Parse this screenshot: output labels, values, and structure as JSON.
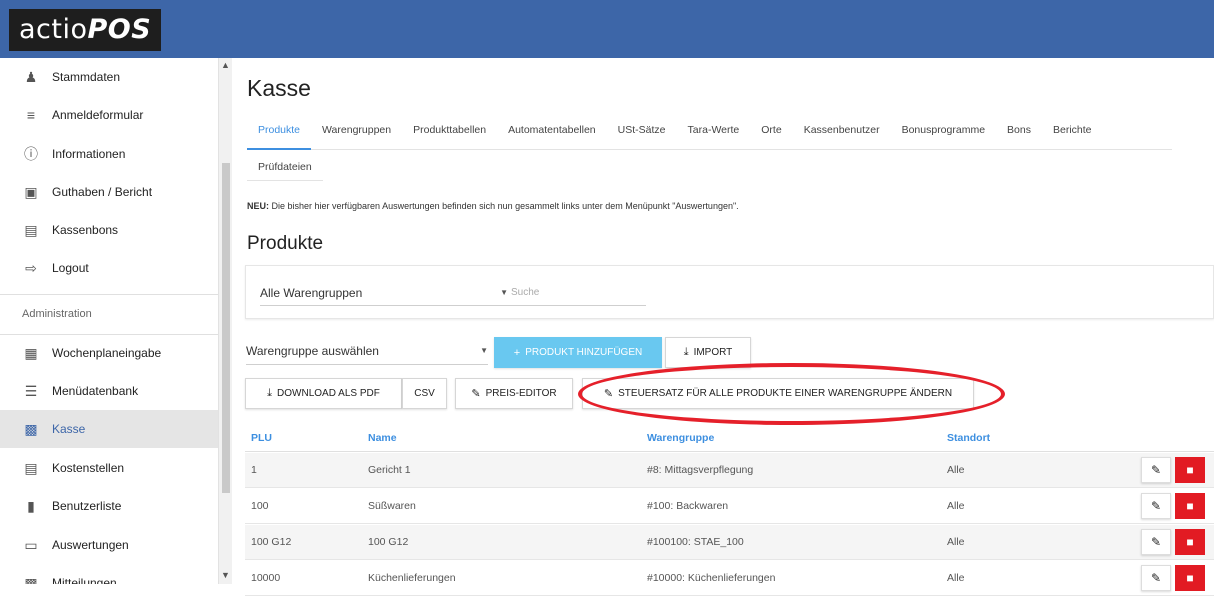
{
  "app": {
    "logo_plain": "actio",
    "logo_bold": "POS"
  },
  "sidebar": {
    "items": [
      {
        "label": "Stammdaten",
        "icon": "person-icon"
      },
      {
        "label": "Anmeldeformular",
        "icon": "form-lines-icon"
      },
      {
        "label": "Informationen",
        "icon": "info-icon"
      },
      {
        "label": "Guthaben / Bericht",
        "icon": "wallet-icon"
      },
      {
        "label": "Kassenbons",
        "icon": "receipt-icon"
      },
      {
        "label": "Logout",
        "icon": "logout-icon"
      }
    ],
    "admin_heading": "Administration",
    "admin_items": [
      {
        "label": "Wochenplaneingabe",
        "icon": "grid-icon"
      },
      {
        "label": "Menüdatenbank",
        "icon": "list-icon"
      },
      {
        "label": "Kasse",
        "icon": "store-icon",
        "active": true
      },
      {
        "label": "Kostenstellen",
        "icon": "clipboard-icon"
      },
      {
        "label": "Benutzerliste",
        "icon": "user-list-icon"
      },
      {
        "label": "Auswertungen",
        "icon": "document-icon"
      },
      {
        "label": "Mitteilungen",
        "icon": "message-icon"
      }
    ]
  },
  "main": {
    "title": "Kasse",
    "tabs": [
      "Produkte",
      "Warengruppen",
      "Produkttabellen",
      "Automatentabellen",
      "USt-Sätze",
      "Tara-Werte",
      "Orte",
      "Kassenbenutzer",
      "Bonusprogramme",
      "Bons",
      "Berichte"
    ],
    "tab_row2": "Prüfdateien",
    "notice_bold": "NEU:",
    "notice_text": " Die bisher hier verfügbaren Auswertungen befinden sich nun gesammelt links unter dem Menüpunkt \"Auswertungen\".",
    "section_title": "Produkte",
    "filter": {
      "group_value": "Alle Warengruppen",
      "search_placeholder": "Suche"
    },
    "toolbar": {
      "wg_select": "Warengruppe auswählen",
      "add_product": "PRODUKT HINZUFÜGEN",
      "import": "IMPORT",
      "download_pdf": "DOWNLOAD ALS PDF",
      "csv": "CSV",
      "price_editor": "PREIS-EDITOR",
      "tax_rate": "STEUERSATZ FÜR ALLE PRODUKTE EINER WARENGRUPPE ÄNDERN"
    },
    "table": {
      "headers": [
        "PLU",
        "Name",
        "Warengruppe",
        "Standort"
      ],
      "rows": [
        [
          "1",
          "Gericht 1",
          "#8: Mittagsverpflegung",
          "Alle"
        ],
        [
          "100",
          "Süßwaren",
          "#100: Backwaren",
          "Alle"
        ],
        [
          "100 G12",
          "100 G12",
          "#100100: STAE_100",
          "Alle"
        ],
        [
          "10000",
          "Küchenlieferungen",
          "#10000: Küchenlieferungen",
          "Alle"
        ]
      ]
    },
    "colors": {
      "accent": "#3d8fe0",
      "topbar": "#3d66a8",
      "danger": "#e21b23",
      "highlight": "#e5202a"
    }
  }
}
